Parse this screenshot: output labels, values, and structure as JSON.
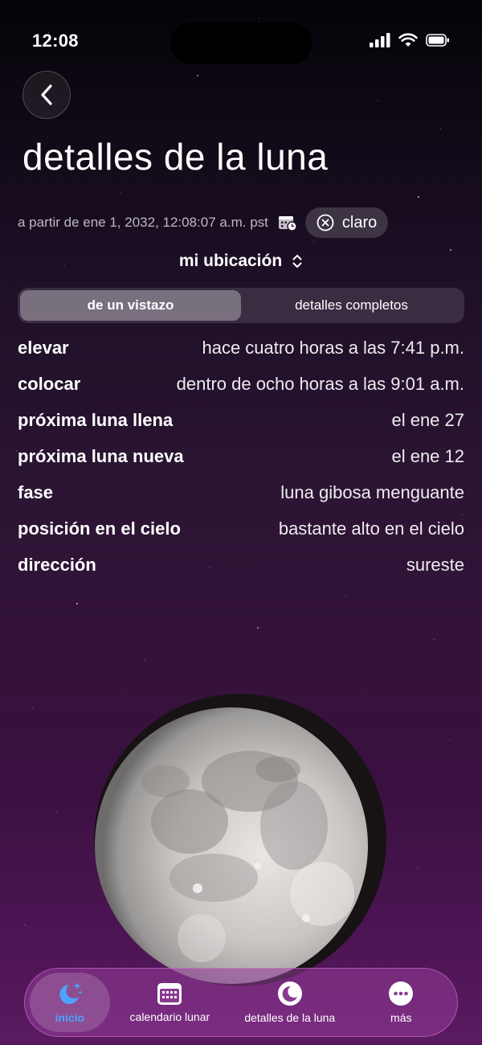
{
  "status_bar": {
    "time": "12:08"
  },
  "header": {
    "title": "detalles de la luna"
  },
  "as_of": {
    "text": "a partir de ene 1, 2032, 12:08:07 a.m. pst",
    "clear_label": "claro"
  },
  "location": {
    "label": "mi ubicación"
  },
  "segments": [
    {
      "label": "de un vistazo",
      "active": true
    },
    {
      "label": "detalles completos",
      "active": false
    }
  ],
  "details": [
    {
      "label": "elevar",
      "value": "hace cuatro horas a las 7:41 p.m."
    },
    {
      "label": "colocar",
      "value": "dentro de ocho horas a las 9:01 a.m."
    },
    {
      "label": "próxima luna llena",
      "value": "el ene 27"
    },
    {
      "label": "próxima luna nueva",
      "value": "el ene 12"
    },
    {
      "label": "fase",
      "value": "luna gibosa menguante"
    },
    {
      "label": "posición en el cielo",
      "value": "bastante alto en el cielo"
    },
    {
      "label": "dirección",
      "value": "sureste"
    }
  ],
  "tabs": [
    {
      "label": "inicio",
      "icon": "moon-stars-icon",
      "active": true
    },
    {
      "label": "calendario lunar",
      "icon": "calendar-grid-icon",
      "active": false
    },
    {
      "label": "detalles de la luna",
      "icon": "moon-circle-icon",
      "active": false
    },
    {
      "label": "más",
      "icon": "more-dots-icon",
      "active": false
    }
  ],
  "colors": {
    "accent": "#4da3ff",
    "tab_bar": "#8a3a90"
  }
}
